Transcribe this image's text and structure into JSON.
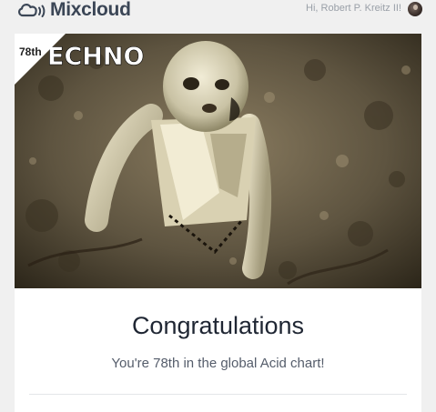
{
  "header": {
    "brand": "Mixcloud",
    "greeting": "Hi, Robert P. Kreitz II!",
    "logo_icon": "mixcloud-cloud-icon",
    "avatar_icon": "user-avatar"
  },
  "card": {
    "rank_badge": "78th",
    "cover_art_text": "ECHNO",
    "title": "Congratulations",
    "message": "You're 78th in the global Acid chart!"
  },
  "colors": {
    "page_bg": "#f0f0f0",
    "brand_text": "#3b4656",
    "title_text": "#1f2633",
    "subtitle_text": "#555d6b"
  }
}
